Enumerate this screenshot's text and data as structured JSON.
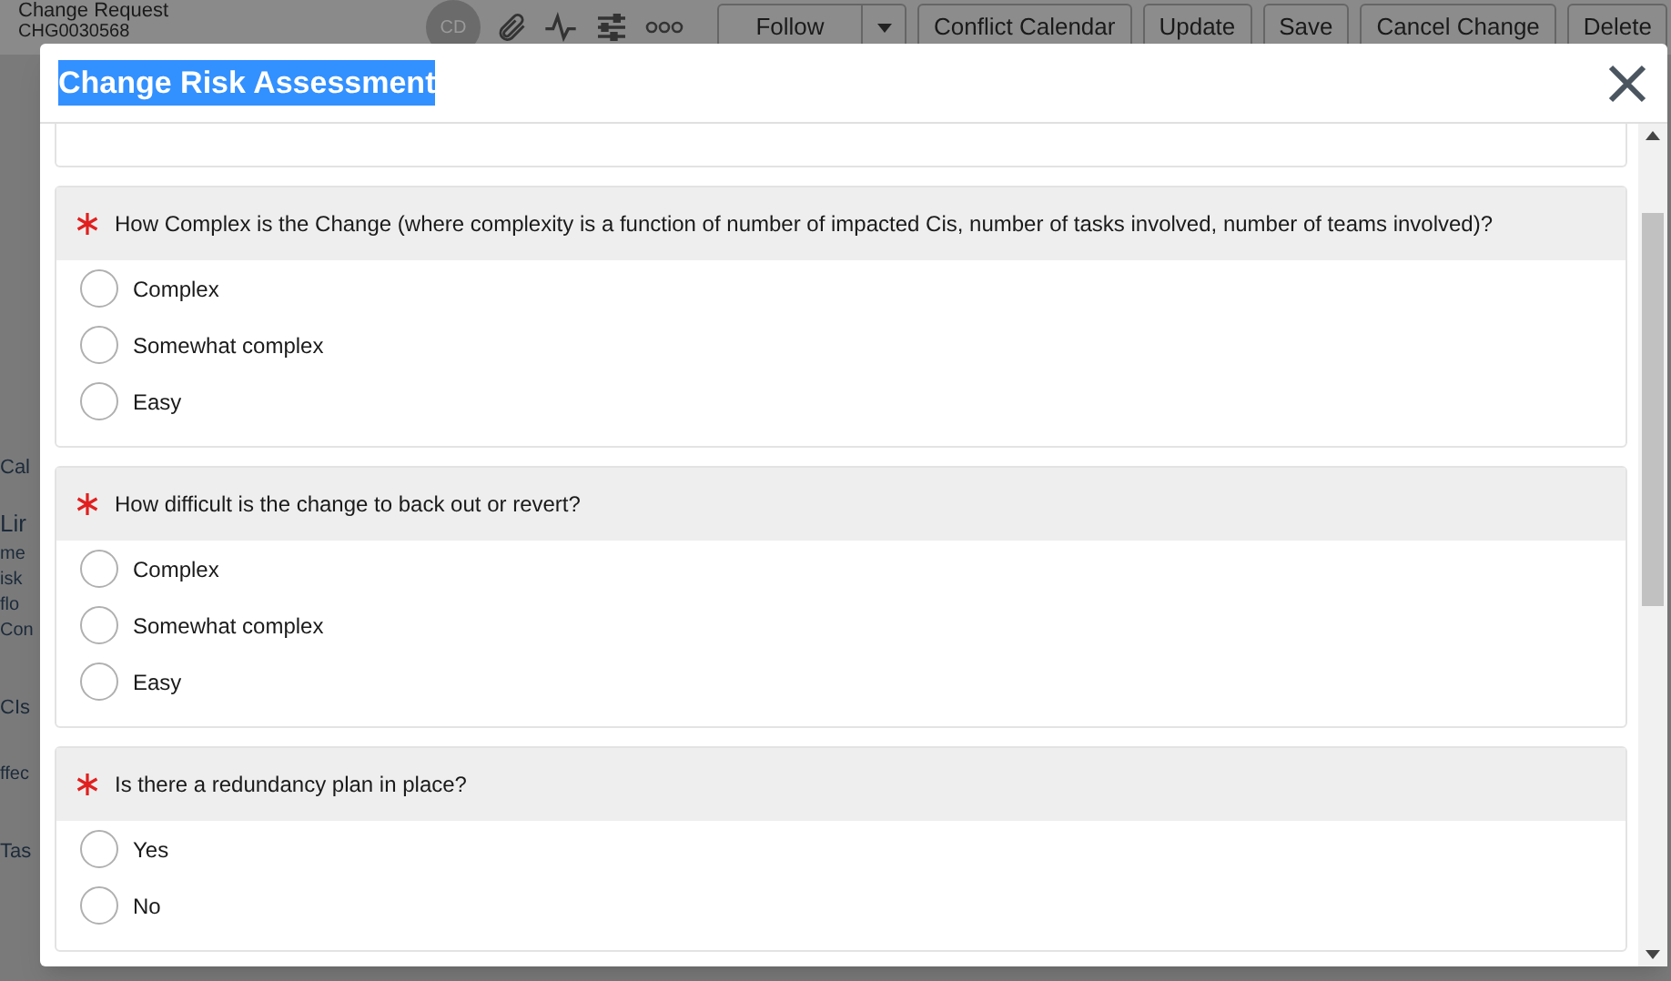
{
  "background": {
    "title": "Change Request",
    "number": "CHG0030568",
    "avatar": "CD",
    "buttons": [
      {
        "label": "Follow",
        "kind": "split"
      },
      {
        "label": "Conflict Calendar",
        "kind": "plain"
      },
      {
        "label": "Update",
        "kind": "plain"
      },
      {
        "label": "Save",
        "kind": "plain"
      },
      {
        "label": "Cancel Change",
        "kind": "plain"
      },
      {
        "label": "Delete",
        "kind": "plain"
      }
    ],
    "side_fragments": [
      "Cal",
      "Lir",
      "me",
      "isk",
      "flo",
      "Con",
      "CIs",
      "ffec",
      "Tas"
    ]
  },
  "dialog": {
    "title": "Change Risk Assessment",
    "title_selected": true,
    "questions": [
      {
        "text": "How Complex is the Change (where complexity is a function of number of impacted Cis, number of tasks involved, number of teams involved)?",
        "required": true,
        "options": [
          {
            "label": "Complex",
            "selected": false
          },
          {
            "label": "Somewhat complex",
            "selected": false
          },
          {
            "label": "Easy",
            "selected": false
          }
        ]
      },
      {
        "text": "How difficult is the change to back out or revert?",
        "required": true,
        "options": [
          {
            "label": "Complex",
            "selected": false
          },
          {
            "label": "Somewhat complex",
            "selected": false
          },
          {
            "label": "Easy",
            "selected": false
          }
        ]
      },
      {
        "text": "Is there a redundancy plan in place?",
        "required": true,
        "options": [
          {
            "label": "Yes",
            "selected": false
          },
          {
            "label": "No",
            "selected": false
          }
        ]
      }
    ]
  }
}
